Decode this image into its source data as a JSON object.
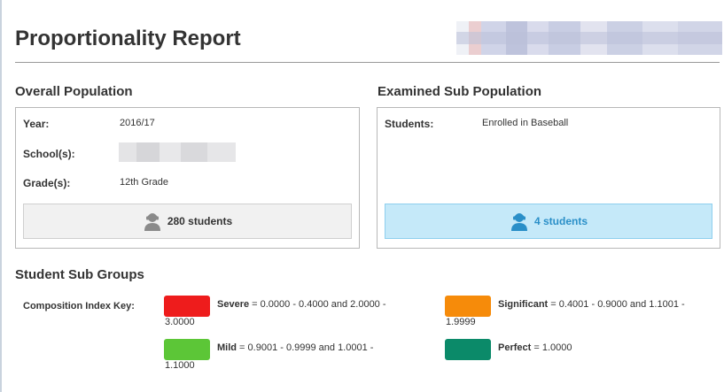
{
  "page": {
    "title": "Proportionality Report"
  },
  "overall": {
    "heading": "Overall Population",
    "year_label": "Year:",
    "year_value": "2016/17",
    "school_label": "School(s):",
    "grade_label": "Grade(s):",
    "grade_value": "12th Grade",
    "count": "280 students"
  },
  "examined": {
    "heading": "Examined Sub Population",
    "students_label": "Students:",
    "students_value": "Enrolled in Baseball",
    "count": "4 students"
  },
  "subgroups": {
    "heading": "Student Sub Groups",
    "key_label": "Composition Index Key:",
    "items": [
      {
        "name": "Severe",
        "range": " = 0.0000 - 0.4000 and 2.0000 -",
        "range_wrap": "3.0000",
        "color": "#ee1c1c"
      },
      {
        "name": "Significant",
        "range": " = 0.4001 - 0.9000 and 1.1001 -",
        "range_wrap": "1.9999",
        "color": "#f68b0a"
      },
      {
        "name": "Mild",
        "range": " = 0.9001 - 0.9999 and 1.0001 -",
        "range_wrap": "1.1000",
        "color": "#5cc637"
      },
      {
        "name": "Perfect",
        "range": " = 1.0000",
        "range_wrap": "",
        "color": "#0b8a69"
      }
    ]
  }
}
